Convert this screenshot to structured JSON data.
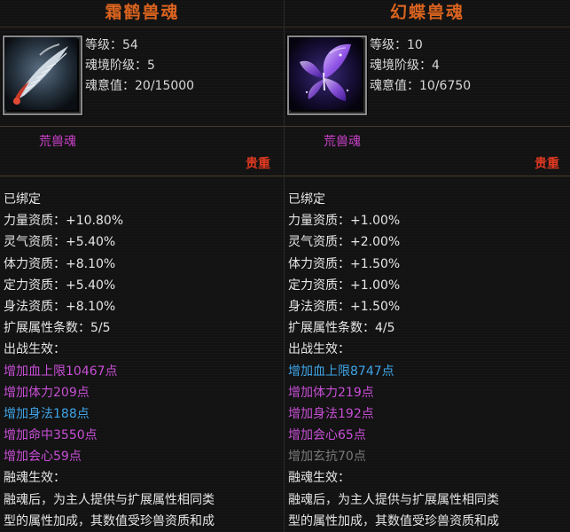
{
  "left": {
    "title": "霜鹤兽魂",
    "icon": "crane-feather-icon",
    "level": "等级：54",
    "realm": "魂境阶级：5",
    "soul_value": "魂意值：20/15000",
    "type": "荒兽魂",
    "rarity": "贵重",
    "bound": "已绑定",
    "attrs": [
      "力量资质：+10.80%",
      "灵气资质：+5.40%",
      "体力资质：+8.10%",
      "定力资质：+5.40%",
      "身法资质：+8.10%",
      "扩展属性条数：5/5",
      "出战生效："
    ],
    "effects": [
      {
        "text": "增加血上限10467点",
        "color": "purple"
      },
      {
        "text": "增加体力209点",
        "color": "purple"
      },
      {
        "text": "增加身法188点",
        "color": "blue"
      },
      {
        "text": "增加命中3550点",
        "color": "purple"
      },
      {
        "text": "增加会心59点",
        "color": "purple"
      }
    ],
    "fusion_title": "融魂生效：",
    "fusion_lines": [
      "融魂后，为主人提供与扩展属性相同类",
      "型的属性加成，其数值受珍兽资质和成"
    ]
  },
  "right": {
    "title": "幻蝶兽魂",
    "icon": "butterfly-icon",
    "level": "等级：10",
    "realm": "魂境阶级：4",
    "soul_value": "魂意值：10/6750",
    "type": "荒兽魂",
    "rarity": "贵重",
    "bound": "已绑定",
    "attrs": [
      "力量资质：+1.00%",
      "灵气资质：+2.00%",
      "体力资质：+1.50%",
      "定力资质：+1.00%",
      "身法资质：+1.50%",
      "扩展属性条数：4/5",
      "出战生效："
    ],
    "effects": [
      {
        "text": "增加血上限8747点",
        "color": "blue"
      },
      {
        "text": "增加体力219点",
        "color": "purple"
      },
      {
        "text": "增加身法192点",
        "color": "purple"
      },
      {
        "text": "增加会心65点",
        "color": "purple"
      },
      {
        "text": "增加玄抗70点",
        "color": "gray"
      }
    ],
    "fusion_title": "融魂生效：",
    "fusion_lines": [
      "融魂后，为主人提供与扩展属性相同类",
      "型的属性加成，其数值受珍兽资质和成"
    ]
  },
  "colors": {
    "title": "#d9631f",
    "type": "#c940c9",
    "rarity": "#e23a22",
    "purple": "#c84fd6",
    "blue": "#3fa5e8",
    "gray": "#7a7a7a"
  }
}
